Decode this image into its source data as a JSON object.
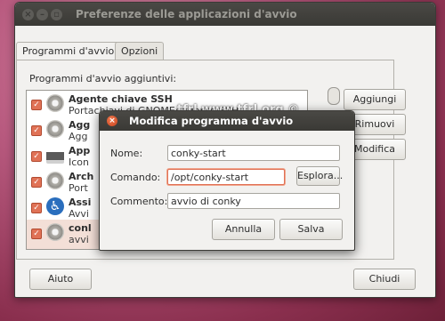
{
  "window": {
    "title": "Preferenze delle applicazioni d'avvio",
    "close_glyph": "×",
    "minimize_glyph": "–",
    "maximize_glyph": "▫"
  },
  "tabs": [
    {
      "label": "Programmi d'avvio",
      "active": true
    },
    {
      "label": "Opzioni",
      "active": false
    }
  ],
  "section_label": "Programmi d'avvio aggiuntivi:",
  "list": {
    "rows": [
      {
        "name": "Agente chiave SSH",
        "desc": "Portachiavi di GNOME: agente SSH",
        "icon": "gear-icon",
        "checked": true,
        "selected": false
      },
      {
        "name": "Agg",
        "desc": "Agg",
        "icon": "gear-icon",
        "checked": true,
        "selected": false
      },
      {
        "name": "App",
        "desc": "Icon",
        "icon": "printer-icon",
        "checked": true,
        "selected": false
      },
      {
        "name": "Arch",
        "desc": "Port",
        "icon": "gear-icon",
        "checked": true,
        "selected": false
      },
      {
        "name": "Assi",
        "desc": "Avvi",
        "icon": "accessibility-icon",
        "checked": true,
        "selected": false
      },
      {
        "name": "conl",
        "desc": "avvi",
        "icon": "gear-icon",
        "checked": true,
        "selected": true
      }
    ],
    "check_glyph": "✓"
  },
  "side_buttons": {
    "add": "Aggiungi",
    "remove": "Rimuovi",
    "edit": "Modifica"
  },
  "footer": {
    "help": "Aiuto",
    "close": "Chiudi"
  },
  "watermark": "tfrl www.tfrl.org ©",
  "dialog": {
    "title": "Modifica programma d'avvio",
    "close_glyph": "×",
    "fields": {
      "name_label": "Nome:",
      "name_value": "conky-start",
      "command_label": "Comando:",
      "command_value": "/opt/conky-start",
      "browse_label": "Esplora...",
      "comment_label": "Commento:",
      "comment_value": "avvio di conky"
    },
    "cancel_label": "Annulla",
    "save_label": "Salva"
  },
  "colors": {
    "accent": "#e07256",
    "titlebar": "#3c3b37",
    "background": "#f2f1ef"
  }
}
